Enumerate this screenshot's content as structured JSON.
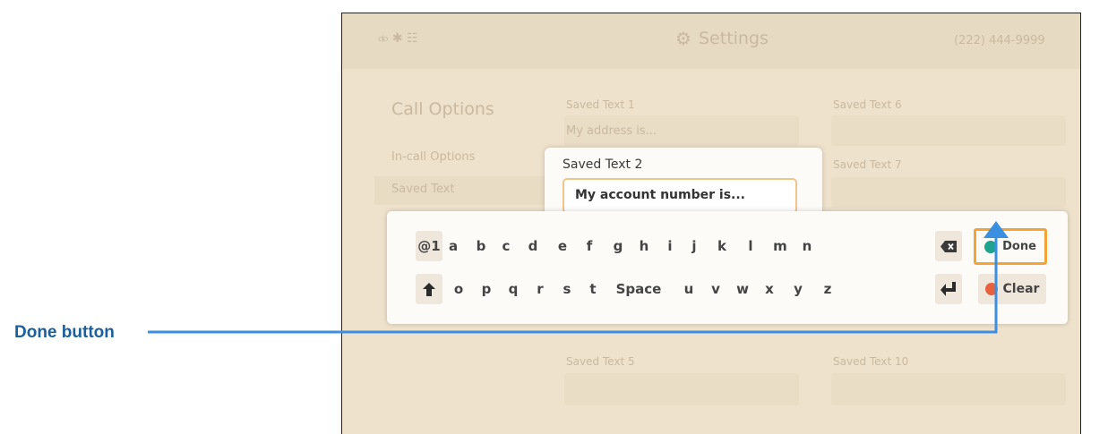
{
  "topbar": {
    "title": "Settings",
    "phone": "(222) 444-9999",
    "status_glyphs": "⧞ ✱ ☷"
  },
  "sidebar": {
    "heading": "Call Options",
    "items": [
      {
        "label": "In-call Options"
      },
      {
        "label": "Saved Text"
      }
    ]
  },
  "saved_texts": {
    "t1": {
      "label": "Saved Text 1",
      "value": "My address is..."
    },
    "t5": {
      "label": "Saved Text 5"
    },
    "t6": {
      "label": "Saved Text 6"
    },
    "t7": {
      "label": "Saved Text 7"
    },
    "t10": {
      "label": "Saved Text 10"
    }
  },
  "popup": {
    "label": "Saved Text 2",
    "value": "My account number is..."
  },
  "keyboard": {
    "row1": [
      "@1",
      "a",
      "b",
      "c",
      "d",
      "e",
      "f",
      "g",
      "h",
      "i",
      "j",
      "k",
      "l",
      "m",
      "n"
    ],
    "row2": [
      "o",
      "p",
      "q",
      "r",
      "s",
      "t",
      "Space",
      "u",
      "v",
      "w",
      "x",
      "y",
      "z"
    ],
    "done": "Done",
    "clear": "Clear",
    "colors": {
      "done_dot": "#1fa38f",
      "clear_dot": "#e8603c",
      "done_border": "#f2a33a"
    }
  },
  "callout": {
    "label": "Done button",
    "color": "#3b8fe0"
  }
}
